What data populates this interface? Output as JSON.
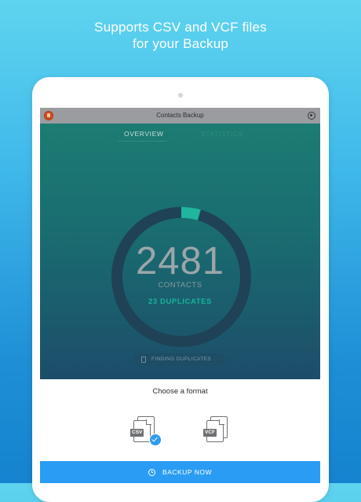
{
  "headline": {
    "line1": "Supports CSV and VCF files",
    "line2": "for your Backup"
  },
  "app": {
    "title": "Contacts Backup",
    "tabs": [
      {
        "label": "OVERVIEW",
        "active": true
      },
      {
        "label": "STATISTICS",
        "active": false
      }
    ]
  },
  "summary": {
    "count": "2481",
    "count_label": "CONTACTS",
    "duplicates_label": "23 DUPLICATES",
    "progress_fraction": 0.045,
    "status": "FINDING DUPLICATES"
  },
  "format": {
    "title": "Choose a format",
    "options": [
      {
        "label": "CSV",
        "selected": true,
        "icon": "csv-file-icon"
      },
      {
        "label": "VCF",
        "selected": false,
        "icon": "vcf-file-icon"
      }
    ]
  },
  "backup_button": {
    "label": "BACKUP NOW",
    "icon": "clock-icon"
  },
  "colors": {
    "accent": "#2b9cf3",
    "ring_track": "#1f4256",
    "ring_progress": "#1fb59e",
    "duplicates": "#17b59b"
  }
}
